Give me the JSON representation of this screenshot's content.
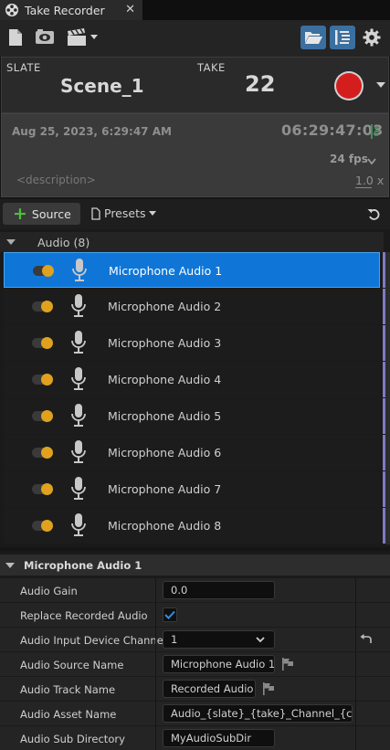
{
  "window": {
    "tab_title": "Take Recorder",
    "close_glyph": "✕"
  },
  "toolbar": {
    "icons": [
      "new-file-icon",
      "review-icon",
      "clapper-icon",
      "open-folder-icon",
      "details-panel-icon",
      "settings-gear-icon"
    ]
  },
  "slate": {
    "slate_label": "SLATE",
    "slate_value": "Scene_1",
    "take_label": "TAKE",
    "take_value": "22"
  },
  "meta": {
    "date": "Aug 25, 2023, 6:29:47 AM",
    "timecode": "06:29:47:03",
    "fps": "24 fps",
    "description_placeholder": "<description>",
    "rate": "1.0 x"
  },
  "sources": {
    "add_label": "Source",
    "presets_label": "Presets",
    "group_label": "Audio (8)",
    "items": [
      {
        "name": "Microphone Audio 1",
        "enabled": true,
        "selected": true
      },
      {
        "name": "Microphone Audio 2",
        "enabled": true,
        "selected": false
      },
      {
        "name": "Microphone Audio 3",
        "enabled": true,
        "selected": false
      },
      {
        "name": "Microphone Audio 4",
        "enabled": true,
        "selected": false
      },
      {
        "name": "Microphone Audio 5",
        "enabled": true,
        "selected": false
      },
      {
        "name": "Microphone Audio 6",
        "enabled": true,
        "selected": false
      },
      {
        "name": "Microphone Audio 7",
        "enabled": true,
        "selected": false
      },
      {
        "name": "Microphone Audio 8",
        "enabled": true,
        "selected": false
      }
    ]
  },
  "details": {
    "header": "Microphone Audio 1",
    "audio_gain_label": "Audio Gain",
    "audio_gain_value": "0.0",
    "replace_label": "Replace Recorded Audio",
    "replace_checked": true,
    "input_channel_label": "Audio Input Device Channel",
    "input_channel_value": "1",
    "source_name_label": "Audio Source Name",
    "source_name_value": "Microphone Audio 1",
    "track_name_label": "Audio Track Name",
    "track_name_value": "Recorded Audio",
    "asset_name_label": "Audio Asset Name",
    "asset_name_value": "Audio_{slate}_{take}_Channel_{channel}",
    "sub_dir_label": "Audio Sub Directory",
    "sub_dir_value": "MyAudioSubDir"
  },
  "colors": {
    "accent_blue": "#0f76d8",
    "record_red": "#d41e1e",
    "toggle_orange": "#e0a21e",
    "add_green": "#4fbf3a"
  }
}
